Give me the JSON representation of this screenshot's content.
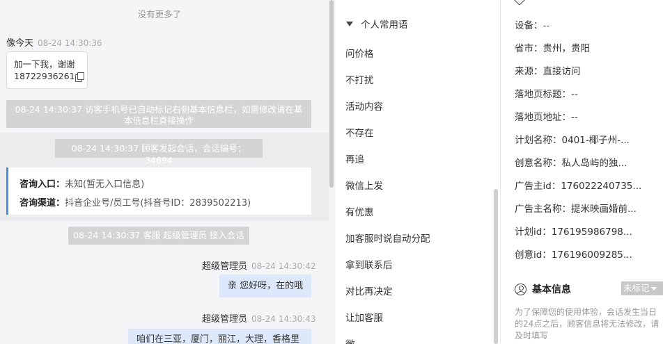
{
  "chat": {
    "no_more": "没有更多了",
    "visitor_msg": {
      "name": "像今天",
      "time": "08-24 14:30:36",
      "line1": "加一下我，谢谢",
      "phone": "18722936261"
    },
    "system_msgs": [
      "08-24 14:30:37 访客手机号已自动标记右侧基本信息栏，如需修改请在基本信息栏直接操作",
      "08-24 14:30:37 顾客发起会话，会话编号：34694",
      "08-24 14:30:37 客服 超级管理员 接入会话"
    ],
    "info_card": {
      "entry_label": "咨询入口：",
      "entry_value": "未知(暂无入口信息)",
      "channel_label": "咨询渠道：",
      "channel_value": "抖音企业号/员工号(抖音号ID：2839502213)"
    },
    "agent_msgs": [
      {
        "name": "超级管理员",
        "time": "08-24 14:30:42",
        "text": "亲 您好呀，在的哦"
      },
      {
        "name": "超级管理员",
        "time": "08-24 14:30:43",
        "text": "咱们在三亚，厦门，丽江，大理，香格里"
      }
    ]
  },
  "phrases": {
    "header": "个人常用语",
    "items": [
      "问价格",
      "不打扰",
      "活动内容",
      "不存在",
      "再追",
      "微信上发",
      "有优惠",
      "加客服时说自动分配",
      "拿到联系后",
      "对比再决定",
      "让加客服",
      "微"
    ]
  },
  "visitor": {
    "rows": [
      {
        "k": "设备：",
        "v": "--"
      },
      {
        "k": "省市：",
        "v": "贵州，贵阳"
      },
      {
        "k": "来源：",
        "v": "直接访问"
      },
      {
        "k": "落地页标题：",
        "v": "--"
      },
      {
        "k": "落地页地址：",
        "v": "--"
      },
      {
        "k": "计划名称：",
        "v": "0401-椰子州-..."
      },
      {
        "k": "创意名称：",
        "v": "私人岛屿的独..."
      },
      {
        "k": "广告主id：",
        "v": "176022240735..."
      },
      {
        "k": "广告主名称：",
        "v": "提米映画婚前..."
      },
      {
        "k": "计划id：",
        "v": "176195986798..."
      },
      {
        "k": "创意id：",
        "v": "176196009285..."
      }
    ],
    "basic_info_title": "基本信息",
    "tag_button": "未标记",
    "note": "为了保障您的使用体验，会话发生当日的24点之后，顾客信息将无法修改，请及时填写"
  }
}
